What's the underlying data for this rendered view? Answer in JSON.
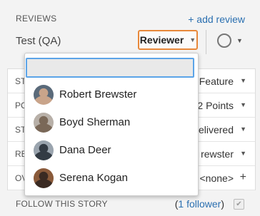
{
  "reviews": {
    "heading": "REVIEWS",
    "add_review": "+ add review",
    "reviewer_name": "Test (QA)",
    "reviewer_select": "Reviewer"
  },
  "fields": [
    {
      "label": "ST",
      "value": "Feature",
      "control": "caret"
    },
    {
      "label": "PC",
      "value": "2 Points",
      "control": "caret"
    },
    {
      "label": "ST",
      "value": "elivered",
      "control": "caret"
    },
    {
      "label": "RE",
      "value": "rewster",
      "control": "caret"
    },
    {
      "label": "OV",
      "value": "<none>",
      "control": "plus"
    }
  ],
  "follow": {
    "label": "FOLLOW THIS STORY",
    "open_paren": "(",
    "count_link": "1 follower",
    "close_paren": ")",
    "checkbox_glyph": "✔"
  },
  "dropdown": {
    "search_value": "",
    "users": [
      {
        "name": "Robert Brewster",
        "avatar_colors": [
          "#5a6a7a",
          "#c9a48a"
        ]
      },
      {
        "name": "Boyd Sherman",
        "avatar_colors": [
          "#b8b0a8",
          "#7a6858"
        ]
      },
      {
        "name": "Dana Deer",
        "avatar_colors": [
          "#9aa4ae",
          "#333b44"
        ]
      },
      {
        "name": "Serena Kogan",
        "avatar_colors": [
          "#8a5a3a",
          "#3a2a22"
        ]
      }
    ]
  },
  "colors": {
    "accent_orange": "#e8883a",
    "link_blue": "#2a6fb0",
    "focus_blue": "#5ba4e8"
  },
  "glyphs": {
    "caret": "▼",
    "plus": "+"
  }
}
